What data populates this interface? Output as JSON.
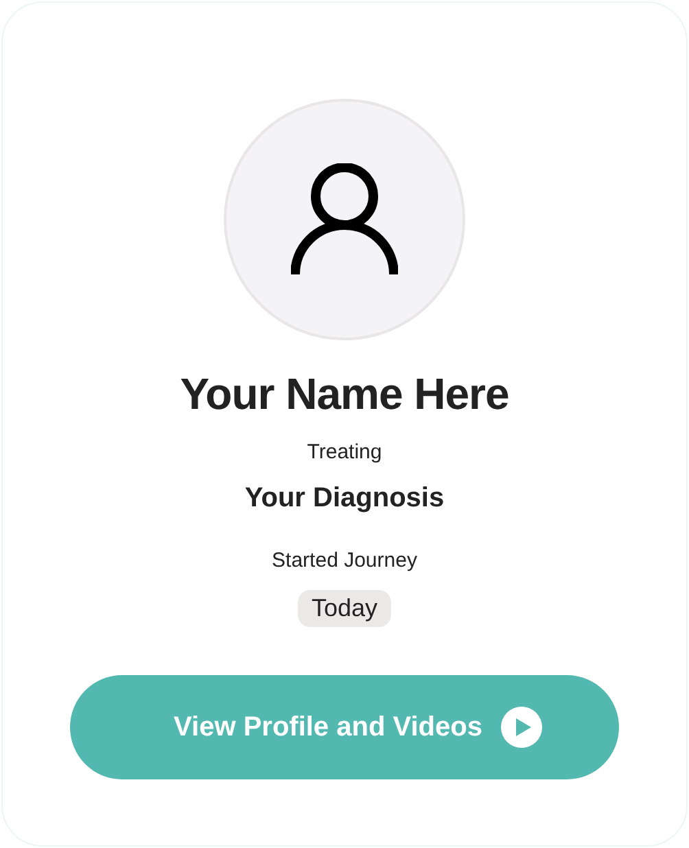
{
  "profile": {
    "name": "Your Name Here",
    "treating_label": "Treating",
    "diagnosis": "Your Diagnosis",
    "started_label": "Started Journey",
    "started_value": "Today"
  },
  "button": {
    "label": "View Profile and Videos"
  }
}
